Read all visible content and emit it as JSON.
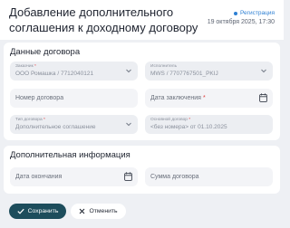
{
  "header": {
    "title": "Добавление дополнительного соглашения к доходному договору",
    "badge": "Регистрация",
    "timestamp": "19 октября 2025, 17:30"
  },
  "contract": {
    "section_title": "Данные договора",
    "customer": {
      "label": "Заказчик",
      "value": "ООО Ромашка / 7712040121"
    },
    "executor": {
      "label": "Исполнитель",
      "value": "MWS / 7707767501_PKIJ"
    },
    "number": {
      "placeholder": "Номер договора"
    },
    "date": {
      "placeholder": "Дата заключения"
    },
    "type": {
      "label": "Тип договора",
      "value": "Дополнительное соглашение"
    },
    "base": {
      "label": "Основной договор",
      "value": "<без номера> от 01.10.2025"
    }
  },
  "extra": {
    "section_title": "Дополнительная информация",
    "end_date": {
      "placeholder": "Дата окончания"
    },
    "amount": {
      "placeholder": "Сумма договора"
    }
  },
  "actions": {
    "save": "Сохранить",
    "cancel": "Отменить"
  },
  "colors": {
    "accent": "#2d7fd3",
    "primary_button": "#1d4d5c",
    "required": "#e03a3a"
  }
}
